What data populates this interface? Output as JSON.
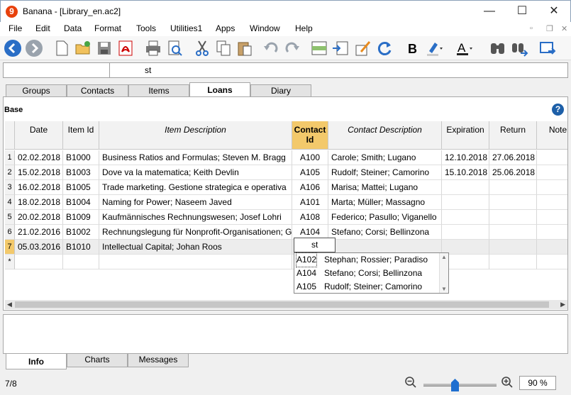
{
  "window": {
    "title": "Banana - [Library_en.ac2]"
  },
  "menu": [
    "File",
    "Edit",
    "Data",
    "Format",
    "Tools",
    "Utilities1",
    "Apps",
    "Window",
    "Help"
  ],
  "cellbar": {
    "value": "st"
  },
  "tabs": [
    "Groups",
    "Contacts",
    "Items",
    "Loans",
    "Diary"
  ],
  "active_tab": "Loans",
  "section": "Base",
  "columns": [
    "Date",
    "Item Id",
    "Item Description",
    "Contact Id",
    "Contact Description",
    "Expiration",
    "Return",
    "Note"
  ],
  "rows": [
    {
      "n": "1",
      "date": "02.02.2018",
      "item": "B1000",
      "desc": "Business Ratios and Formulas; Steven M. Bragg",
      "cid": "A100",
      "cdesc": "Carole; Smith; Lugano",
      "exp": "12.10.2018",
      "ret": "27.06.2018"
    },
    {
      "n": "2",
      "date": "15.02.2018",
      "item": "B1003",
      "desc": "Dove va la matematica; Keith Devlin",
      "cid": "A105",
      "cdesc": "Rudolf; Steiner; Camorino",
      "exp": "15.10.2018",
      "ret": "25.06.2018"
    },
    {
      "n": "3",
      "date": "16.02.2018",
      "item": "B1005",
      "desc": "Trade marketing. Gestione strategica e operativa",
      "cid": "A106",
      "cdesc": "Marisa; Mattei; Lugano",
      "exp": "",
      "ret": ""
    },
    {
      "n": "4",
      "date": "18.02.2018",
      "item": "B1004",
      "desc": "Naming for Power; Naseem Javed",
      "cid": "A101",
      "cdesc": "Marta; Müller; Massagno",
      "exp": "",
      "ret": ""
    },
    {
      "n": "5",
      "date": "20.02.2018",
      "item": "B1009",
      "desc": "Kaufmännisches Rechnungswesen; Josef Lohri",
      "cid": "A108",
      "cdesc": "Federico; Pasullo; Viganello",
      "exp": "",
      "ret": ""
    },
    {
      "n": "6",
      "date": "21.02.2016",
      "item": "B1002",
      "desc": "Rechnungslegung für Nonprofit-Organisationen; G",
      "cid": "A104",
      "cdesc": "Stefano; Corsi; Bellinzona",
      "exp": "",
      "ret": ""
    },
    {
      "n": "7",
      "date": "05.03.2016",
      "item": "B1010",
      "desc": "Intellectual Capital; Johan Roos",
      "cid": "",
      "cdesc": "",
      "exp": "",
      "ret": ""
    }
  ],
  "new_row_marker": "*",
  "editor_value": "st",
  "dropdown": [
    {
      "id": "A102",
      "desc": "Stephan; Rossier; Paradiso"
    },
    {
      "id": "A104",
      "desc": "Stefano; Corsi; Bellinzona"
    },
    {
      "id": "A105",
      "desc": "Rudolf; Steiner; Camorino"
    }
  ],
  "bottom_tabs": [
    "Info",
    "Charts",
    "Messages"
  ],
  "status": {
    "position": "7/8",
    "zoom": "90 %"
  },
  "colors": {
    "selection": "#f3c96b",
    "accent": "#1f6fd0"
  }
}
